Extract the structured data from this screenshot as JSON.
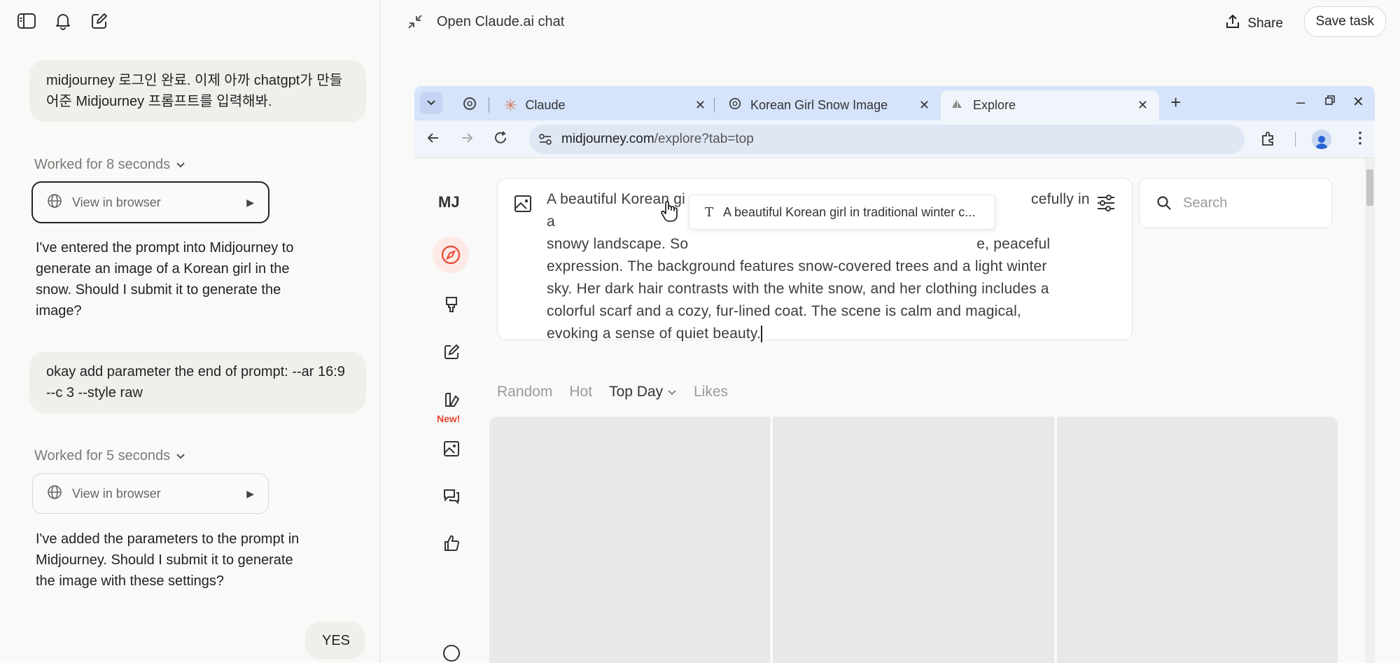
{
  "left_panel": {
    "messages": [
      {
        "role": "user",
        "text": "midjourney 로그인 완료. 이제 아까 chatgpt가 만들어준 Midjourney 프롬프트를 입력해봐."
      },
      {
        "role": "status",
        "text": "Worked for 8 seconds"
      },
      {
        "role": "tool",
        "text": "View in browser"
      },
      {
        "role": "assistant",
        "text": "I've entered the prompt into Midjourney to generate an image of a Korean girl in the snow. Should I submit it to generate the image?"
      },
      {
        "role": "user",
        "text": "okay add parameter the end of prompt: --ar 16:9 --c 3 --style raw"
      },
      {
        "role": "status",
        "text": "Worked for 5 seconds"
      },
      {
        "role": "tool",
        "text": "View in browser"
      },
      {
        "role": "assistant",
        "text": "I've added the parameters to the prompt in Midjourney. Should I submit it to generate the image with these settings?"
      },
      {
        "role": "user",
        "text": "YES"
      }
    ]
  },
  "header": {
    "title": "Open Claude.ai chat",
    "share_label": "Share",
    "save_label": "Save task"
  },
  "browser": {
    "tabs": [
      {
        "label": "Claude"
      },
      {
        "label": "Korean Girl Snow Image"
      },
      {
        "label": "Explore",
        "active": true
      }
    ],
    "url_host": "midjourney.com",
    "url_path": "/explore?tab=top"
  },
  "midjourney": {
    "logo": "MJ",
    "new_badge": "New!",
    "prompt_text": "A beautiful Korean girl in traditional winter clothing stands gracefully in a snowy landscape. Soft snowflakes fall around her, she has a gentle, peaceful expression. The background features snow-covered trees and a light winter sky. Her dark hair contrasts with the white snow, and her clothing includes a colorful scarf and a cozy, fur-lined coat. The scene is calm and magical, evoking a sense of quiet beauty.",
    "prompt_visible": "A beautiful Korean gi",
    "prompt_visible_2": "cefully in a",
    "prompt_line2_a": "snowy landscape. So",
    "prompt_line2_b": "e, peaceful",
    "prompt_line3": "expression. The background features snow-covered trees and a light winter",
    "prompt_line4": "sky. Her dark hair contrasts with the white snow, and her clothing includes a",
    "prompt_line5": "colorful scarf and a cozy, fur-lined coat. The scene is calm and magical,",
    "prompt_line6": "evoking a sense of quiet beauty.",
    "tooltip_text": "A beautiful Korean girl in traditional winter c...",
    "search_placeholder": "Search",
    "filters": [
      "Random",
      "Hot",
      "Top Day",
      "Likes"
    ]
  }
}
